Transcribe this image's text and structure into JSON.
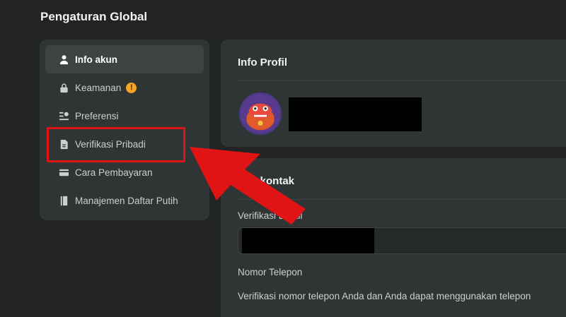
{
  "page": {
    "title": "Pengaturan Global"
  },
  "sidebar": {
    "items": [
      {
        "label": "Info akun",
        "icon": "user-icon",
        "active": true
      },
      {
        "label": "Keamanan",
        "icon": "lock-icon",
        "badge": "!"
      },
      {
        "label": "Preferensi",
        "icon": "preferences-icon"
      },
      {
        "label": "Verifikasi Pribadi",
        "icon": "document-icon"
      },
      {
        "label": "Cara Pembayaran",
        "icon": "card-icon"
      },
      {
        "label": "Manajemen Daftar Putih",
        "icon": "book-icon"
      }
    ]
  },
  "profile": {
    "title": "Info Profil"
  },
  "contact": {
    "title": "Info kontak",
    "email_label": "Verifikasi Email",
    "phone_label": "Nomor Telepon",
    "phone_desc": "Verifikasi nomor telepon Anda dan Anda dapat menggunakan telepon"
  },
  "colors": {
    "highlight": "#e01414",
    "warning": "#f5a623"
  }
}
